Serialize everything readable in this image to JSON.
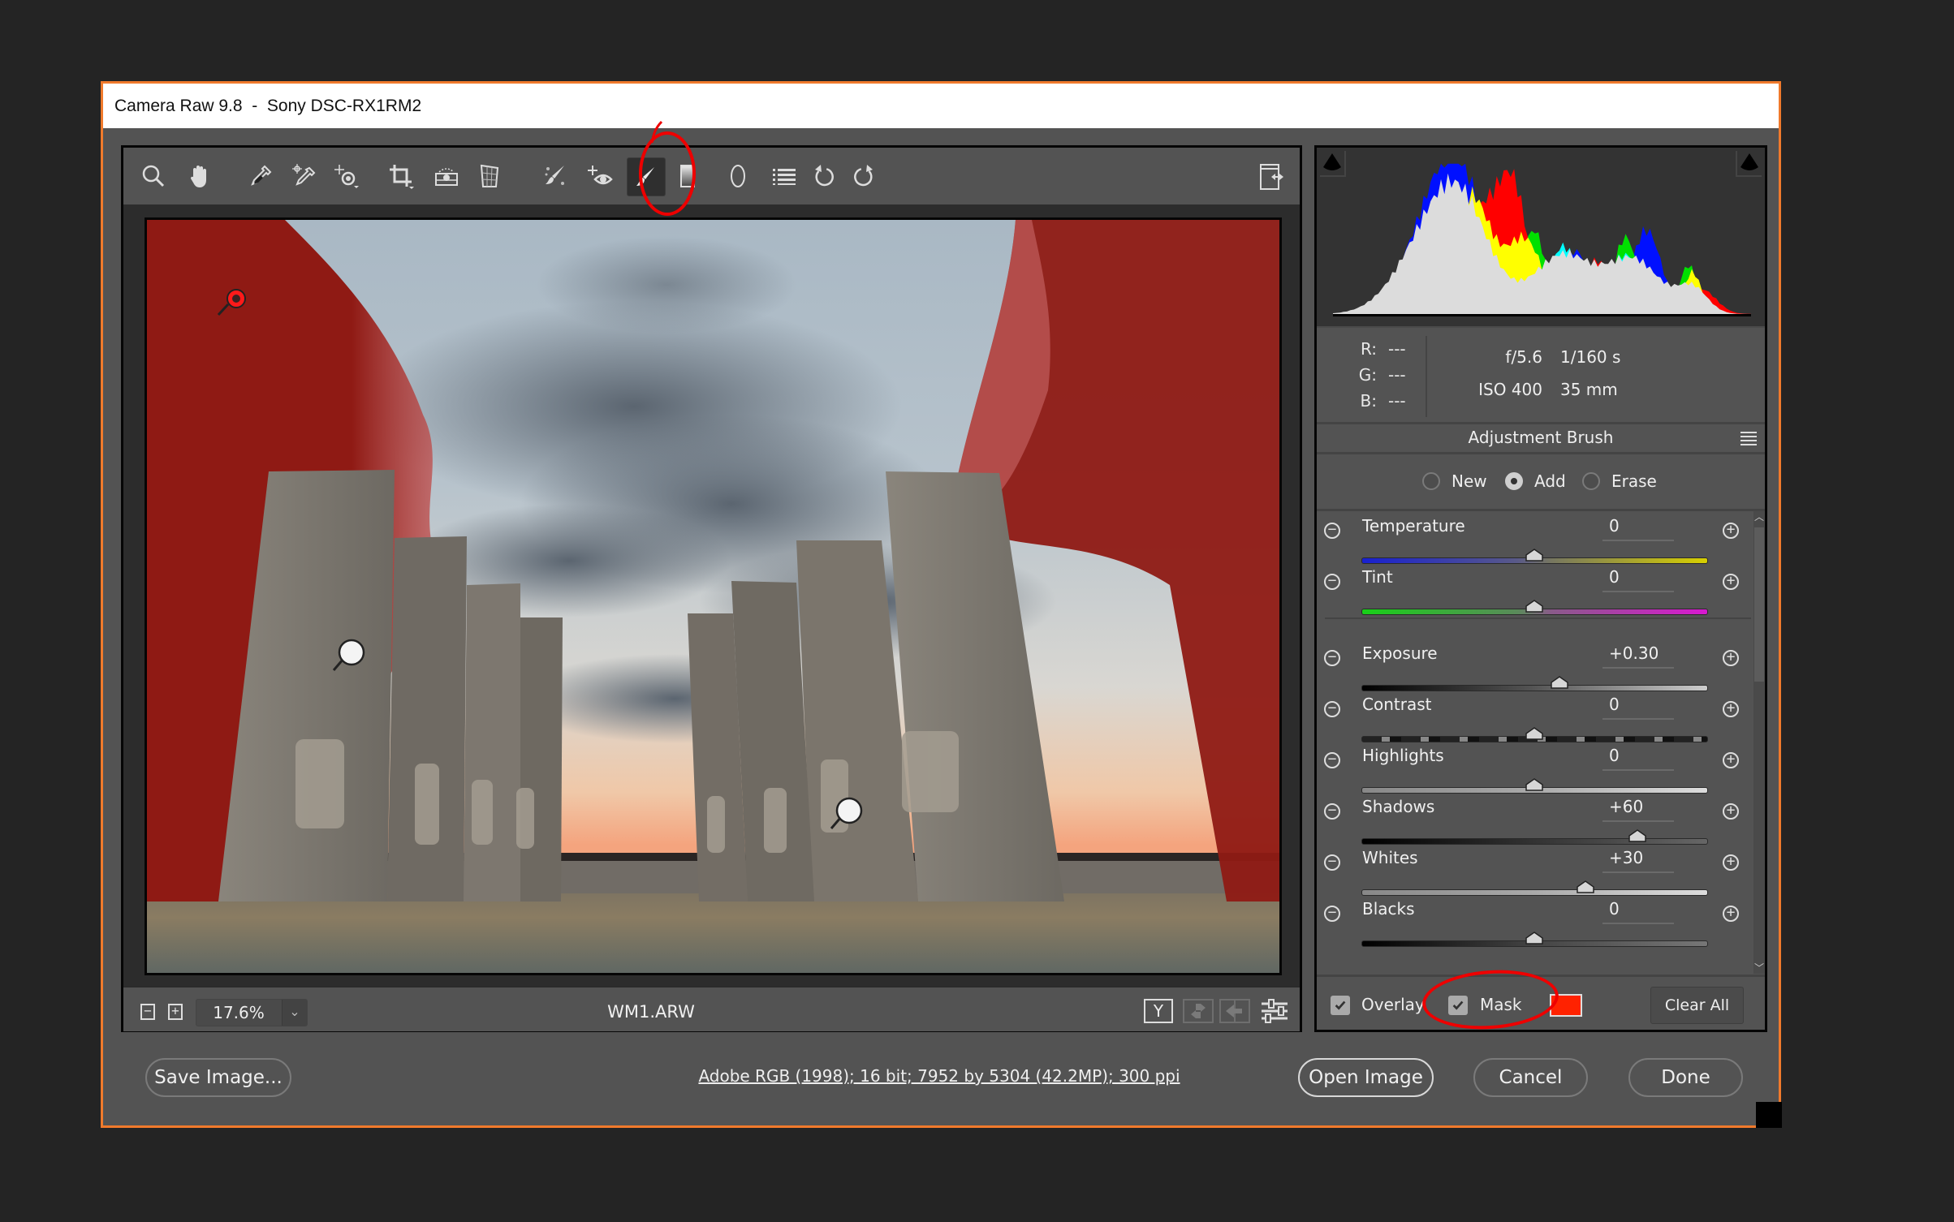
{
  "window": {
    "title_app": "Camera Raw 9.8",
    "title_sep": "-",
    "title_camera": "Sony DSC-RX1RM2"
  },
  "toolbar": {
    "tools": [
      {
        "name": "zoom-tool",
        "icon": "magnifier-icon"
      },
      {
        "name": "hand-tool",
        "icon": "hand-icon"
      },
      {
        "name": "white-balance-tool",
        "icon": "eyedropper-icon"
      },
      {
        "name": "color-sampler-tool",
        "icon": "eyedropper-target-icon"
      },
      {
        "name": "targeted-adjustment-tool",
        "icon": "target-adjust-icon"
      },
      {
        "name": "crop-tool",
        "icon": "crop-icon"
      },
      {
        "name": "straighten-tool",
        "icon": "level-icon"
      },
      {
        "name": "transform-tool",
        "icon": "transform-grid-icon"
      },
      {
        "name": "spot-removal-tool",
        "icon": "spot-brush-icon"
      },
      {
        "name": "red-eye-removal-tool",
        "icon": "red-eye-icon"
      },
      {
        "name": "adjustment-brush-tool",
        "icon": "brush-icon",
        "active": true
      },
      {
        "name": "graduated-filter-tool",
        "icon": "gradient-icon"
      },
      {
        "name": "radial-filter-tool",
        "icon": "ellipse-icon"
      },
      {
        "name": "preferences-tool",
        "icon": "list-icon"
      },
      {
        "name": "rotate-left-tool",
        "icon": "rotate-ccw-icon"
      },
      {
        "name": "rotate-right-tool",
        "icon": "rotate-cw-icon"
      }
    ],
    "fullscreen_icon": "toggle-fullscreen-icon"
  },
  "preview": {
    "mask_color": "#ff2200",
    "pins": [
      {
        "state": "selected",
        "color": "#ff1a1a"
      },
      {
        "state": "inactive",
        "color": "#ffffff"
      },
      {
        "state": "inactive",
        "color": "#ffffff"
      }
    ]
  },
  "statusbar": {
    "zoom_out": "−",
    "zoom_in": "+",
    "zoom_value": "17.6%",
    "zoom_dropdown": "⌄",
    "filename": "WM1.ARW",
    "view_toggle_label": "Y"
  },
  "histogram": {
    "channels": [
      "red",
      "green",
      "blue",
      "cyan",
      "magenta",
      "yellow",
      "luminance"
    ]
  },
  "info": {
    "r_label": "R:",
    "r_value": "---",
    "g_label": "G:",
    "g_value": "---",
    "b_label": "B:",
    "b_value": "---",
    "aperture": "f/5.6",
    "shutter": "1/160 s",
    "iso": "ISO 400",
    "focal_length": "35 mm"
  },
  "panel": {
    "title": "Adjustment Brush",
    "modes": [
      {
        "label": "New",
        "selected": false
      },
      {
        "label": "Add",
        "selected": true
      },
      {
        "label": "Erase",
        "selected": false
      }
    ],
    "sliders": [
      {
        "label": "Temperature",
        "value": "0",
        "position": 0.5,
        "track": "temperature"
      },
      {
        "label": "Tint",
        "value": "0",
        "position": 0.5,
        "track": "tint"
      },
      {
        "label": "Exposure",
        "value": "+0.30",
        "position": 0.575,
        "track": "exposure"
      },
      {
        "label": "Contrast",
        "value": "0",
        "position": 0.5,
        "track": "contrast"
      },
      {
        "label": "Highlights",
        "value": "0",
        "position": 0.5,
        "track": "highlights"
      },
      {
        "label": "Shadows",
        "value": "+60",
        "position": 0.8,
        "track": "shadows"
      },
      {
        "label": "Whites",
        "value": "+30",
        "position": 0.65,
        "track": "whites"
      },
      {
        "label": "Blacks",
        "value": "0",
        "position": 0.5,
        "track": "blacks"
      }
    ],
    "minus_symbol": "−",
    "plus_symbol": "+",
    "overlay_label": "Overlay",
    "overlay_checked": true,
    "mask_label": "Mask",
    "mask_checked": true,
    "mask_color": "#ff2200",
    "clear_all_label": "Clear All"
  },
  "footer": {
    "save_label": "Save Image...",
    "workflow_info": "Adobe RGB (1998); 16 bit; 7952 by 5304 (42.2MP); 300 ppi",
    "open_label": "Open Image",
    "cancel_label": "Cancel",
    "done_label": "Done"
  },
  "annotations": {
    "color": "#ee0000",
    "circled": [
      "adjustment-brush-tool",
      "mask-checkbox"
    ]
  }
}
